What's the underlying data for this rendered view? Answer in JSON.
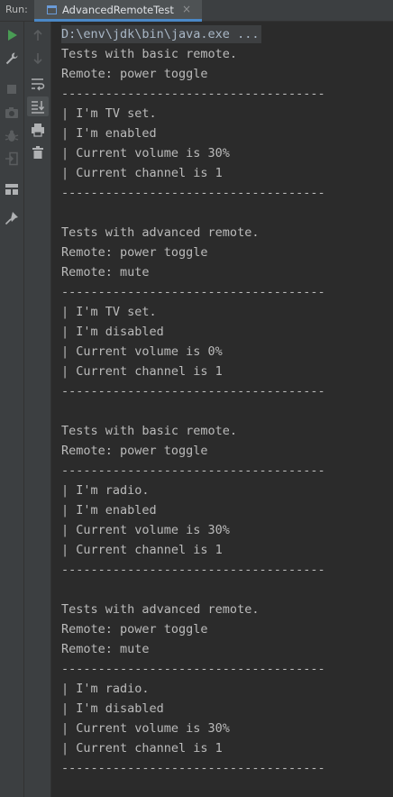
{
  "run_label": "Run:",
  "tab": {
    "title": "AdvancedRemoteTest",
    "close": "×"
  },
  "console": {
    "lines": [
      "D:\\env\\jdk\\bin\\java.exe ...",
      "Tests with basic remote.",
      "Remote: power toggle",
      "------------------------------------",
      "| I'm TV set.",
      "| I'm enabled",
      "| Current volume is 30%",
      "| Current channel is 1",
      "------------------------------------",
      "",
      "Tests with advanced remote.",
      "Remote: power toggle",
      "Remote: mute",
      "------------------------------------",
      "| I'm TV set.",
      "| I'm disabled",
      "| Current volume is 0%",
      "| Current channel is 1",
      "------------------------------------",
      "",
      "Tests with basic remote.",
      "Remote: power toggle",
      "------------------------------------",
      "| I'm radio.",
      "| I'm enabled",
      "| Current volume is 30%",
      "| Current channel is 1",
      "------------------------------------",
      "",
      "Tests with advanced remote.",
      "Remote: power toggle",
      "Remote: mute",
      "------------------------------------",
      "| I'm radio.",
      "| I'm disabled",
      "| Current volume is 30%",
      "| Current channel is 1",
      "------------------------------------"
    ]
  },
  "toolbar_left": [
    "rerun-icon",
    "settings-wrench-icon",
    "stop-icon",
    "camera-dump-icon",
    "debug-bug-icon",
    "exit-icon",
    "layout-icon",
    "pin-icon"
  ],
  "toolbar_right": [
    "scroll-up-icon",
    "scroll-down-icon",
    "soft-wrap-icon",
    "scroll-to-end-icon",
    "print-icon",
    "clear-all-icon"
  ],
  "colors": {
    "run_green": "#499c54",
    "accent_blue": "#4a88c7",
    "console_bg": "#2b2b2b",
    "panel_bg": "#3c3f41",
    "text": "#bbbbbb"
  }
}
